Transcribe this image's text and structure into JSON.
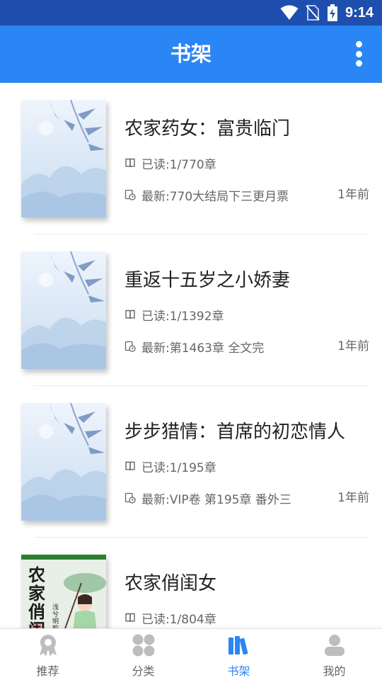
{
  "status_bar": {
    "time": "9:14"
  },
  "app_bar": {
    "title": "书架"
  },
  "books": [
    {
      "title": "农家药女：富贵临门",
      "read": "已读:1/770章",
      "latest": "最新:770大结局下三更月票",
      "time_ago": "1年前",
      "cover": "default"
    },
    {
      "title": "重返十五岁之小娇妻",
      "read": "已读:1/1392章",
      "latest": "最新:第1463章 全文完",
      "time_ago": "1年前",
      "cover": "default"
    },
    {
      "title": "步步猎情：首席的初恋情人",
      "read": "已读:1/195章",
      "latest": "最新:VIP卷 第195章 番外三",
      "time_ago": "1年前",
      "cover": "default"
    },
    {
      "title": "农家俏闺女",
      "read": "已读:1/804章",
      "latest": "",
      "time_ago": "",
      "cover": "illustrated",
      "cover_text": "农家俏闺女",
      "cover_author": "浅兮明韵"
    }
  ],
  "bottom_nav": [
    {
      "label": "推荐",
      "icon": "award-ribbon-icon",
      "active": false
    },
    {
      "label": "分类",
      "icon": "category-grid-icon",
      "active": false
    },
    {
      "label": "书架",
      "icon": "bookshelf-icon",
      "active": true
    },
    {
      "label": "我的",
      "icon": "user-profile-icon",
      "active": false
    }
  ],
  "colors": {
    "primary": "#2a86f4",
    "status_bar": "#1e4fae",
    "text_primary": "#222222",
    "text_secondary": "#666666"
  }
}
